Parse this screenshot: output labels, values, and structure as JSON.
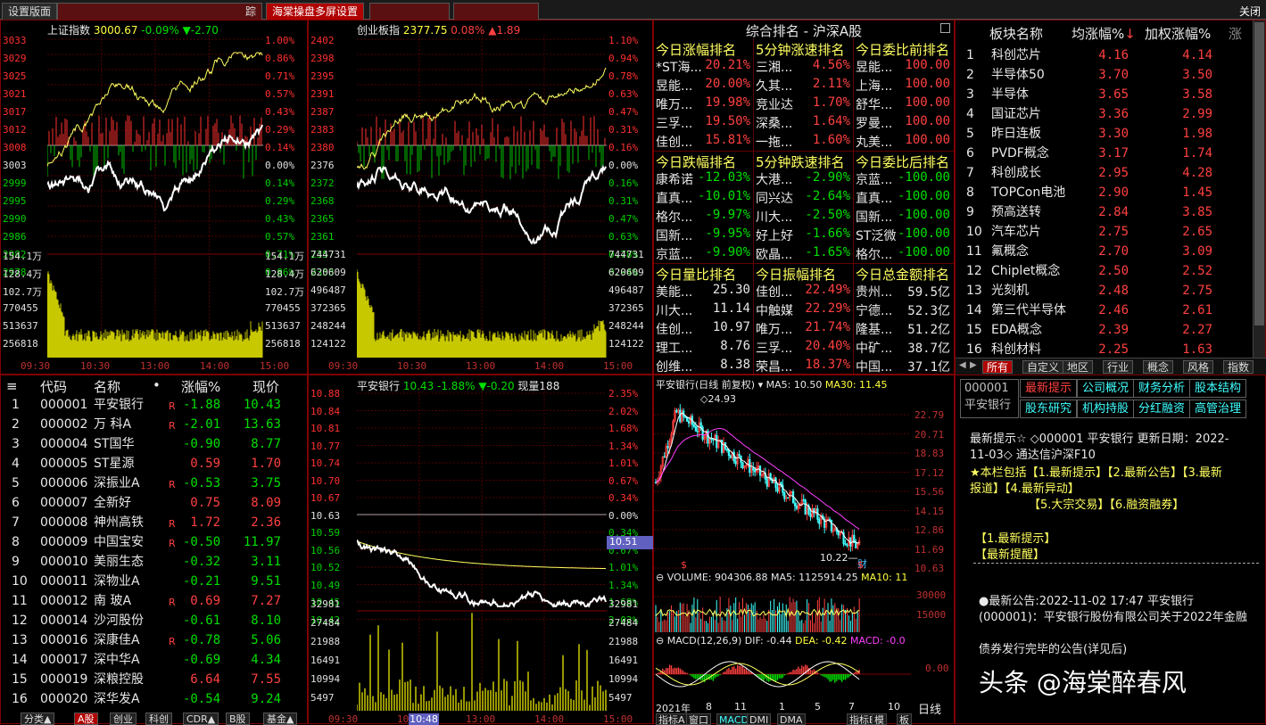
{
  "tabs": {
    "settings": "设置版面",
    "tab2": "踪",
    "active": "海棠操盘多屏设置",
    "close": "关闭"
  },
  "sh": {
    "name": "上证指数",
    "value": "3000.67",
    "pct": "-0.09%",
    "chg": "▼-2.70",
    "left": [
      "3033",
      "3029",
      "3025",
      "3021",
      "3017",
      "3012",
      "3008",
      "3003",
      "2999",
      "2995",
      "2990",
      "2986",
      "2982",
      "2978"
    ],
    "right": [
      "1.00%",
      "0.86%",
      "0.71%",
      "0.57%",
      "0.43%",
      "0.29%",
      "0.14%",
      "0.00%",
      "0.14%",
      "0.29%",
      "0.43%",
      "0.57%",
      "0.71%",
      "0.86%"
    ],
    "vol": [
      "154.1万",
      "128.4万",
      "102.7万",
      "770455",
      "513637",
      "256818"
    ],
    "times": [
      "09:30",
      "10:30",
      "13:00",
      "14:00",
      "15:00"
    ]
  },
  "cy": {
    "name": "创业板指",
    "value": "2377.75",
    "pct": "0.08%",
    "chg": "▲1.89",
    "left": [
      "2402",
      "2398",
      "2395",
      "2391",
      "2387",
      "2383",
      "2380",
      "2376",
      "2372",
      "2368",
      "2365",
      "2361",
      "2357",
      "2353"
    ],
    "right": [
      "1.10%",
      "0.94%",
      "0.78%",
      "0.63%",
      "0.47%",
      "0.31%",
      "0.16%",
      "0.00%",
      "0.16%",
      "0.31%",
      "0.47%",
      "0.63%",
      "0.78%",
      "0.94%"
    ],
    "vol": [
      "744731",
      "620609",
      "496487",
      "372365",
      "248244",
      "124122"
    ],
    "times": [
      "09:30",
      "10:30",
      "13:00",
      "14:00",
      "15:00"
    ]
  },
  "rank": {
    "title": "综合排名 - 沪深A股",
    "blocks": [
      {
        "title": "今日涨幅排名",
        "rows": [
          [
            "*ST海...",
            "20.21%"
          ],
          [
            "昱能...",
            "20.00%"
          ],
          [
            "唯万...",
            "19.98%"
          ],
          [
            "三孚...",
            "19.50%"
          ],
          [
            "佳创...",
            "15.81%"
          ]
        ],
        "color": "red"
      },
      {
        "title": "5分钟涨速排名",
        "rows": [
          [
            "三湘...",
            "4.56%"
          ],
          [
            "久其...",
            "2.11%"
          ],
          [
            "竞业达",
            "1.70%"
          ],
          [
            "深桑...",
            "1.64%"
          ],
          [
            "一拖...",
            "1.60%"
          ]
        ],
        "color": "red"
      },
      {
        "title": "今日委比前排名",
        "rows": [
          [
            "昱能...",
            "100.00"
          ],
          [
            "上海...",
            "100.00"
          ],
          [
            "舒华...",
            "100.00"
          ],
          [
            "罗曼...",
            "100.00"
          ],
          [
            "丸美...",
            "100.00"
          ]
        ],
        "color": "red"
      },
      {
        "title": "今日跌幅排名",
        "rows": [
          [
            "康希诺",
            "-12.03%"
          ],
          [
            "直真...",
            "-10.01%"
          ],
          [
            "格尔...",
            "-9.97%"
          ],
          [
            "国新...",
            "-9.95%"
          ],
          [
            "京蓝...",
            "-9.90%"
          ]
        ],
        "color": "grn"
      },
      {
        "title": "5分钟跌速排名",
        "rows": [
          [
            "大港...",
            "-2.90%"
          ],
          [
            "同兴达",
            "-2.64%"
          ],
          [
            "川大...",
            "-2.50%"
          ],
          [
            "好上好",
            "-1.66%"
          ],
          [
            "欧晶...",
            "-1.65%"
          ]
        ],
        "color": "grn"
      },
      {
        "title": "今日委比后排名",
        "rows": [
          [
            "京蓝...",
            "-100.00"
          ],
          [
            "直真...",
            "-100.00"
          ],
          [
            "国新...",
            "-100.00"
          ],
          [
            "ST泛微",
            "-100.00"
          ],
          [
            "格尔...",
            "-100.00"
          ]
        ],
        "color": "grn"
      },
      {
        "title": "今日量比排名",
        "rows": [
          [
            "美能...",
            "25.30"
          ],
          [
            "川大...",
            "11.14"
          ],
          [
            "佳创...",
            "10.97"
          ],
          [
            "理工...",
            "8.76"
          ],
          [
            "创维...",
            "8.38"
          ]
        ],
        "color": "wht"
      },
      {
        "title": "今日振幅排名",
        "rows": [
          [
            "佳创...",
            "22.49%"
          ],
          [
            "中触媒",
            "22.29%"
          ],
          [
            "唯万...",
            "21.74%"
          ],
          [
            "三孚...",
            "20.40%"
          ],
          [
            "荣昌...",
            "18.37%"
          ]
        ],
        "color": "red"
      },
      {
        "title": "今日总金额排名",
        "rows": [
          [
            "贵州...",
            "59.5亿"
          ],
          [
            "宁德...",
            "52.3亿"
          ],
          [
            "隆基...",
            "51.2亿"
          ],
          [
            "中矿...",
            "38.7亿"
          ],
          [
            "中国...",
            "37.1亿"
          ]
        ],
        "color": "wht"
      }
    ]
  },
  "sectors": {
    "headers": [
      "板块名称",
      "均涨幅%",
      "加权涨幅%",
      "涨"
    ],
    "rows": [
      [
        "1",
        "科创芯片",
        "4.16",
        "4.14"
      ],
      [
        "2",
        "半导体50",
        "3.70",
        "3.50"
      ],
      [
        "3",
        "半导体",
        "3.65",
        "3.58"
      ],
      [
        "4",
        "国证芯片",
        "3.36",
        "2.99"
      ],
      [
        "5",
        "昨日连板",
        "3.30",
        "1.98"
      ],
      [
        "6",
        "PVDF概念",
        "3.17",
        "1.74"
      ],
      [
        "7",
        "科创成长",
        "2.95",
        "4.28"
      ],
      [
        "8",
        "TOPCon电池",
        "2.90",
        "1.45"
      ],
      [
        "9",
        "预高送转",
        "2.84",
        "3.85"
      ],
      [
        "10",
        "汽车芯片",
        "2.75",
        "2.65"
      ],
      [
        "11",
        "氟概念",
        "2.70",
        "3.09"
      ],
      [
        "12",
        "Chiplet概念",
        "2.50",
        "2.52"
      ],
      [
        "13",
        "光刻机",
        "2.48",
        "2.75"
      ],
      [
        "14",
        "第三代半导体",
        "2.46",
        "2.61"
      ],
      [
        "15",
        "EDA概念",
        "2.39",
        "2.27"
      ],
      [
        "16",
        "科创材料",
        "2.25",
        "1.63"
      ]
    ],
    "tabs": [
      "所有",
      "自定义",
      "地区",
      "行业",
      "概念",
      "风格",
      "指数"
    ]
  },
  "stocks": {
    "headers": [
      "代码",
      "名称",
      "•",
      "涨幅%",
      "现价"
    ],
    "rows": [
      [
        "1",
        "000001",
        "平安银行",
        "R",
        "-1.88",
        "10.43"
      ],
      [
        "2",
        "000002",
        "万 科A",
        "R",
        "-2.01",
        "13.63"
      ],
      [
        "3",
        "000004",
        "ST国华",
        "",
        "-0.90",
        "8.77"
      ],
      [
        "4",
        "000005",
        "ST星源",
        "",
        "0.59",
        "1.70"
      ],
      [
        "5",
        "000006",
        "深振业A",
        "R",
        "-0.53",
        "3.75"
      ],
      [
        "6",
        "000007",
        "全新好",
        "",
        "0.75",
        "8.09"
      ],
      [
        "7",
        "000008",
        "神州高铁",
        "R",
        "1.72",
        "2.36"
      ],
      [
        "8",
        "000009",
        "中国宝安",
        "R",
        "-0.50",
        "11.97"
      ],
      [
        "9",
        "000010",
        "美丽生态",
        "",
        "-0.32",
        "3.11"
      ],
      [
        "10",
        "000011",
        "深物业A",
        "",
        "-0.21",
        "9.51"
      ],
      [
        "11",
        "000012",
        "南 玻A",
        "R",
        "0.69",
        "7.27"
      ],
      [
        "12",
        "000014",
        "沙河股份",
        "",
        "-0.61",
        "8.10"
      ],
      [
        "13",
        "000016",
        "深康佳A",
        "R",
        "-0.78",
        "5.06"
      ],
      [
        "14",
        "000017",
        "深中华A",
        "",
        "-0.69",
        "4.34"
      ],
      [
        "15",
        "000019",
        "深粮控股",
        "",
        "6.64",
        "7.55"
      ],
      [
        "16",
        "000020",
        "深华发A",
        "",
        "-0.54",
        "9.24"
      ]
    ],
    "tabs": [
      "分类▲",
      "A股",
      "创业",
      "科创",
      "CDR▲",
      "B股",
      "基金▲"
    ]
  },
  "pa": {
    "name": "平安银行",
    "value": "10.43",
    "pct": "-1.88%",
    "chg": "▼-0.20",
    "vollabel": "现量188",
    "cursor": "10.51",
    "timecursor": "10:48",
    "left": [
      "10.88",
      "10.84",
      "10.81",
      "10.77",
      "10.74",
      "10.70",
      "10.67",
      "10.63",
      "10.59",
      "10.56",
      "10.52",
      "10.49",
      "10.45",
      "10.42"
    ],
    "right": [
      "2.35%",
      "2.02%",
      "1.68%",
      "1.34%",
      "1.01%",
      "0.67%",
      "0.34%",
      "0.00%",
      "0.34%",
      "0.67%",
      "1.01%",
      "1.34%",
      "1.68%",
      "2.02%"
    ],
    "vol": [
      "32981",
      "27484",
      "21988",
      "16491",
      "10994",
      "5497"
    ],
    "times": [
      "09:30",
      "10:3",
      "13:00",
      "14:00",
      "15:00"
    ]
  },
  "kline": {
    "title": "平安银行(日线 前复权)",
    "ma5": "MA5: 10.50",
    "ma30": "MA30: 11.45",
    "high": "24.93",
    "low": "10.22",
    "low_tag": "财",
    "scale": [
      "22.79",
      "20.71",
      "18.83",
      "17.12",
      "15.56",
      "14.15",
      "12.86",
      "11.69",
      "10.63"
    ],
    "volume": "VOLUME: 904306.88",
    "vma5": "MA5: 1125914.25",
    "vma10": "MA10: 11",
    "vscale": [
      "30000",
      "15000"
    ],
    "macd": "MACD(12,26,9)",
    "dif": "DIF: -0.44",
    "dea": "DEA: -0.42",
    "macdv": "MACD: -0.0",
    "mscale": "0.00",
    "dates": [
      "2021年",
      "8",
      "11",
      "1",
      "5",
      "7",
      "10"
    ],
    "period": "日线",
    "bottom": [
      "指标A",
      "窗口",
      "MACD",
      "DMI",
      "DMA"
    ],
    "bottom2": [
      "指标B",
      "模",
      "板"
    ]
  },
  "f10": {
    "code": "000001",
    "name": "平安银行",
    "buttons": [
      "最新提示",
      "公司概况",
      "财务分析",
      "股本结构",
      "股东研究",
      "机构持股",
      "分红融资",
      "高管治理"
    ],
    "lines": [
      "最新提示☆ ◇000001 平安银行 更新日期：2022-",
      "11-03◇ 通达信沪深F10",
      "★本栏包括【1.最新提示】【2.最新公告】【3.最新",
      "报道】【4.最新异动】",
      "【5.大宗交易】【6.融资融券】",
      "【1.最新提示】",
      "【最新提醒】",
      "●最新公告:2022-11-02 17:47 平安银行",
      "(000001)：平安银行股份有限公司关于2022年金融",
      "债券发行完毕的公告(详见后)"
    ],
    "watermark": "头条 @海棠醉春风"
  }
}
